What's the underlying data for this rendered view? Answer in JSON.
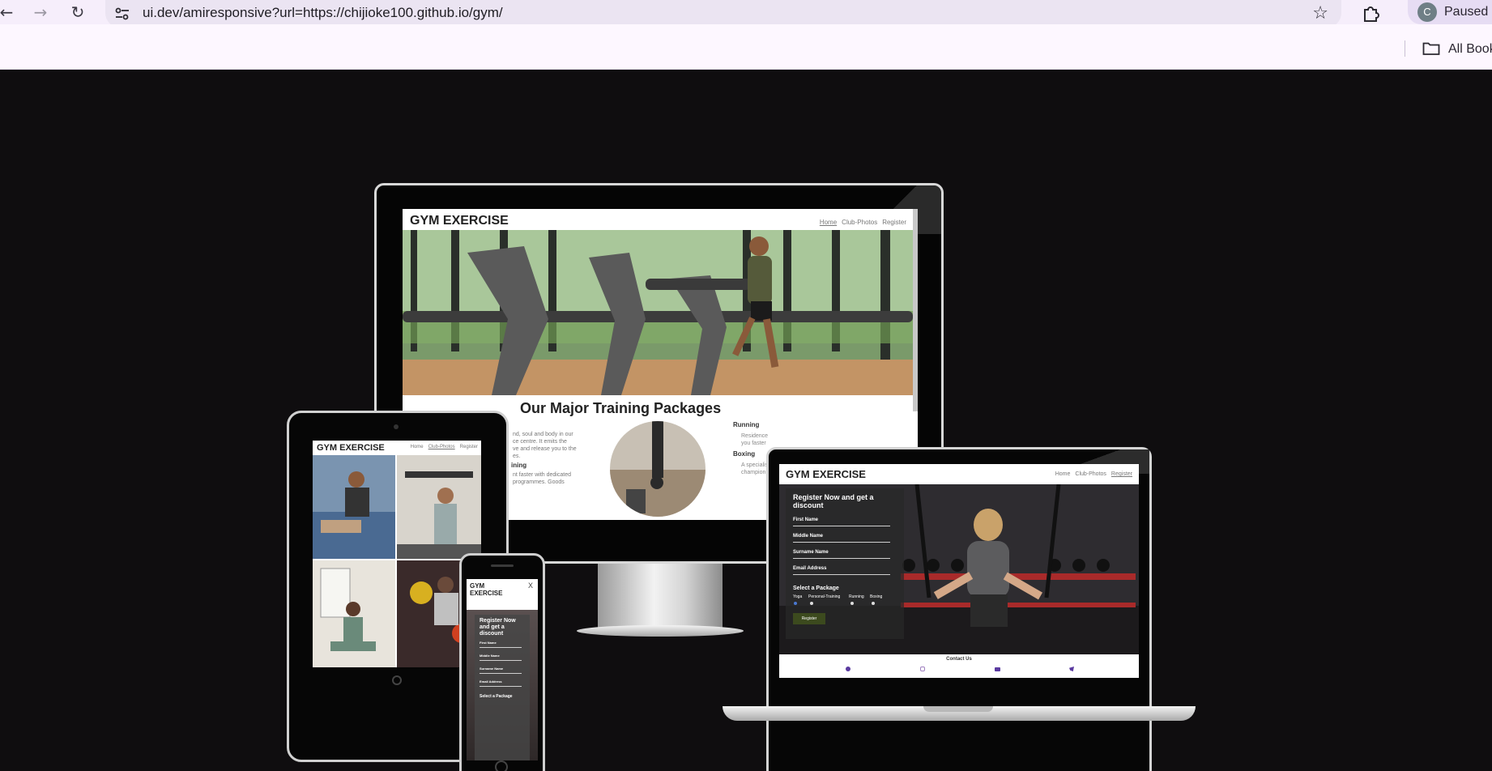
{
  "browser": {
    "url": "ui.dev/amiresponsive?url=https://chijioke100.github.io/gym/",
    "profile_initial": "C",
    "profile_status": "Paused",
    "bookmarks_label": "All Book"
  },
  "site": {
    "title": "GYM EXERCISE",
    "title_mobile": [
      "GYM",
      "EXERCISE"
    ],
    "nav": [
      "Home",
      "Club-Photos",
      "Register"
    ],
    "section_title": "Our Major Training Packages",
    "packages": [
      "Running",
      "Boxing"
    ],
    "text_fragments": {
      "left_1": "nd, soul and body in our",
      "left_2": "ce centre. It emits the",
      "left_3": "ve and release you to the",
      "left_4": "es.",
      "left_heading": "ining",
      "left_5": "nt faster with dedicated",
      "left_6": "programmes. Goods",
      "right_1": "Residence",
      "right_2": "you faster",
      "right_3": "A specialis",
      "right_4": "champion"
    },
    "form": {
      "heading": "Register Now and get a discount",
      "heading_mobile": [
        "Register Now",
        "and get a",
        "discount"
      ],
      "fields": [
        "First Name",
        "Middle Name",
        "Surname Name",
        "Email Address"
      ],
      "select_label": "Select a Package",
      "options": [
        "Yoga",
        "Personal-Training",
        "Running",
        "Boxing"
      ],
      "submit": "Register"
    },
    "footer": {
      "contact": "Contact Us",
      "socials": [
        "facebook-icon",
        "instagram-icon",
        "youtube-icon",
        "twitter-icon"
      ]
    },
    "close_glyph": "X"
  }
}
